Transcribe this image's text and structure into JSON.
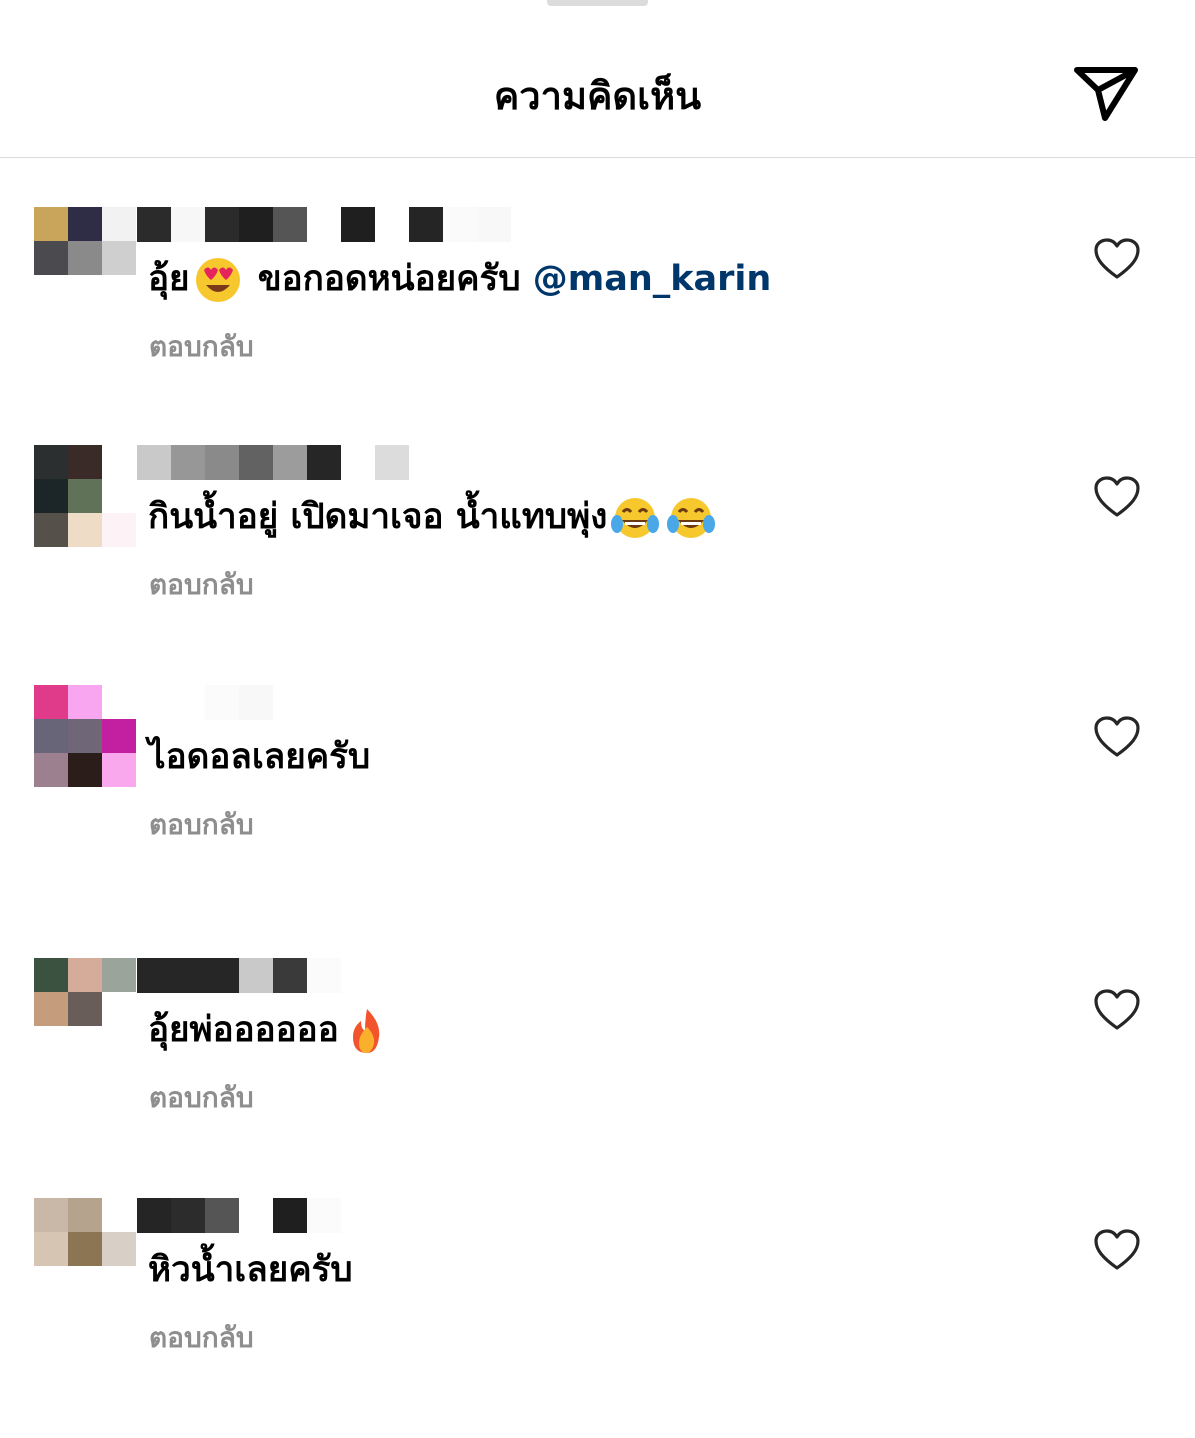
{
  "header": {
    "title": "ความคิดเห็น",
    "send_icon": "send-icon"
  },
  "reply_label": "ตอบกลับ",
  "comments": [
    {
      "text": "อุ้ย",
      "emojis": [
        "heart-eyes"
      ],
      "text_after": "ขอกอดหน่อยครับ",
      "mention": "@man_karin",
      "reply": "ตอบกลับ",
      "avatar_colors": [
        "#c8a55a",
        "#2e2d45",
        "#f2f2f2",
        "#4a4a4f",
        "#8a8a8a",
        "#cfcfcf"
      ],
      "name_colors": [
        "#2b2b2b",
        "#f7f7f7",
        "#2b2b2b",
        "#1f1f1f",
        "#555555",
        "#ffffff",
        "#1f1f1f",
        "#ffffff",
        "#252525",
        "#fafafa",
        "#f8f8f8"
      ]
    },
    {
      "text": "กินน้ำอยู่ เปิดมาเจอ น้ำแทบพุ่ง",
      "emojis": [
        "laughing-tears",
        "laughing-tears"
      ],
      "reply": "ตอบกลับ",
      "avatar_colors": [
        "#2b2f30",
        "#3a2b28",
        "#ffffff",
        "#1c2528",
        "#607258",
        "#ffffff",
        "#56504a",
        "#efdcc6",
        "#fdf2f6"
      ],
      "name_colors": [
        "#c9c9c9",
        "#979797",
        "#8a8a8a",
        "#626262",
        "#9c9c9c",
        "#262626",
        "#ffffff",
        "#dcdcdc"
      ]
    },
    {
      "text": "ไอดอลเลยครับ",
      "emojis": [],
      "reply": "ตอบกลับ",
      "avatar_colors": [
        "#e03a8b",
        "#f9a6f0",
        "#ffffff",
        "#696578",
        "#6f6778",
        "#c21fa1",
        "#9c8090",
        "#2b1e1a",
        "#f9a8ee"
      ],
      "name_colors": [
        "#ffffff",
        "#ffffff",
        "#fbfbfb",
        "#f8f8f8",
        "#ffffff"
      ]
    },
    {
      "text": "อุ้ยพ่ออออออ",
      "emojis": [
        "fire"
      ],
      "reply": "ตอบกลับ",
      "avatar_colors": [
        "#3c5240",
        "#d5ab99",
        "#9aa49b",
        "#c59d7c",
        "#695d5a",
        "#ffffff"
      ],
      "name_colors": [
        "#262626",
        "#262626",
        "#262626",
        "#c9c9c9",
        "#3a3a3a",
        "#fbfbfb"
      ]
    },
    {
      "text": "หิวน้ำเลยครับ",
      "emojis": [],
      "reply": "ตอบกลับ",
      "avatar_colors": [
        "#c9b8a8",
        "#b6a38e",
        "#ffffff",
        "#d6c5b2",
        "#8b7553",
        "#d8cfc6"
      ],
      "name_colors": [
        "#252525",
        "#2c2c2c",
        "#555555",
        "#ffffff",
        "#1f1f1f",
        "#fbfbfb"
      ]
    }
  ]
}
